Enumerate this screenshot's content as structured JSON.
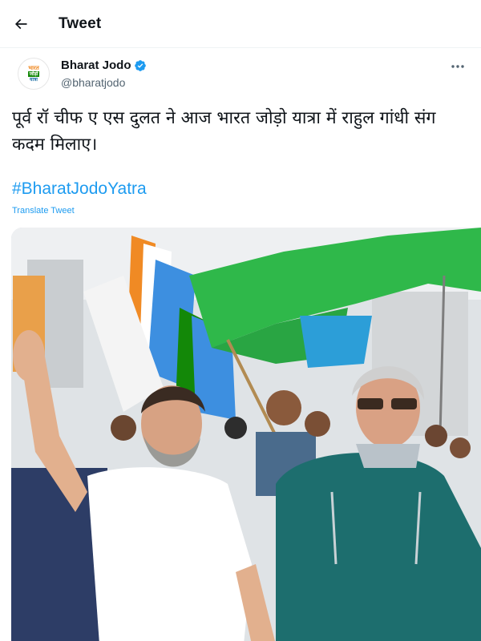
{
  "header": {
    "title": "Tweet",
    "back_icon": "arrow-left-icon"
  },
  "author": {
    "name": "Bharat Jodo",
    "handle": "@bharatjodo",
    "verified": true,
    "avatar_text": [
      "भारत",
      "जोड़ो",
      "यात्रा"
    ]
  },
  "tweet": {
    "text": "पूर्व रॉ चीफ ए एस दुलत ने आज भारत जोड़ो यात्रा में राहुल गांधी संग कदम मिलाए।",
    "hashtag": "#BharatJodoYatra",
    "translate_label": "Translate Tweet"
  },
  "colors": {
    "link": "#1d9bf0",
    "verified": "#1d9bf0",
    "text": "#0f1419",
    "secondary": "#536471"
  }
}
